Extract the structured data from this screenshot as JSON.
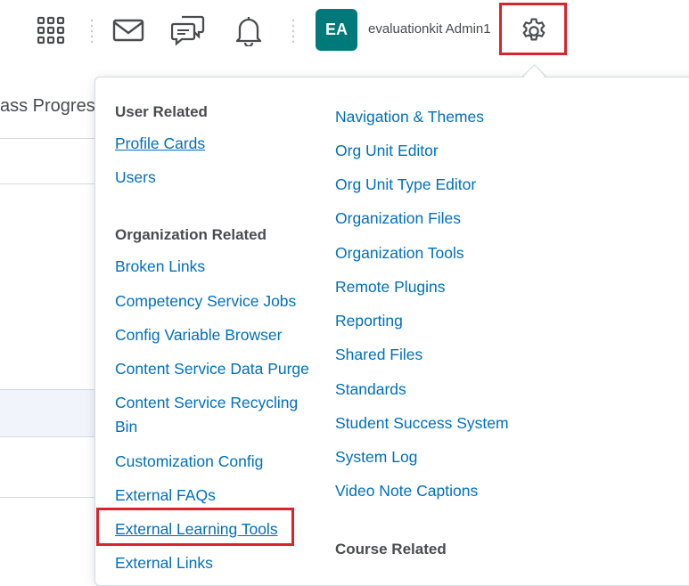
{
  "header": {
    "avatar_initials": "EA",
    "username": "evaluationkit Admin1",
    "icons": [
      "apps-grid-icon",
      "mail-icon",
      "chat-icon",
      "bell-icon",
      "gear-icon"
    ],
    "highlight_color": "#d9232d",
    "avatar_color": "#00797b"
  },
  "background": {
    "page_title": "ass Progres"
  },
  "admin_menu": {
    "left_column": {
      "user_related": {
        "heading": "User Related",
        "items": [
          "Profile Cards",
          "Users"
        ]
      },
      "organization_related": {
        "heading": "Organization Related",
        "items": [
          "Broken Links",
          "Competency Service Jobs",
          "Config Variable Browser",
          "Content Service Data Purge",
          "Content Service Recycling Bin",
          "Customization Config",
          "External FAQs",
          "External Learning Tools",
          "External Links"
        ]
      }
    },
    "right_column": {
      "items": [
        "Navigation & Themes",
        "Org Unit Editor",
        "Org Unit Type Editor",
        "Organization Files",
        "Organization Tools",
        "Remote Plugins",
        "Reporting",
        "Shared Files",
        "Standards",
        "Student Success System",
        "System Log",
        "Video Note Captions"
      ],
      "course_related_heading": "Course Related"
    },
    "link_color": "#006fbf"
  }
}
